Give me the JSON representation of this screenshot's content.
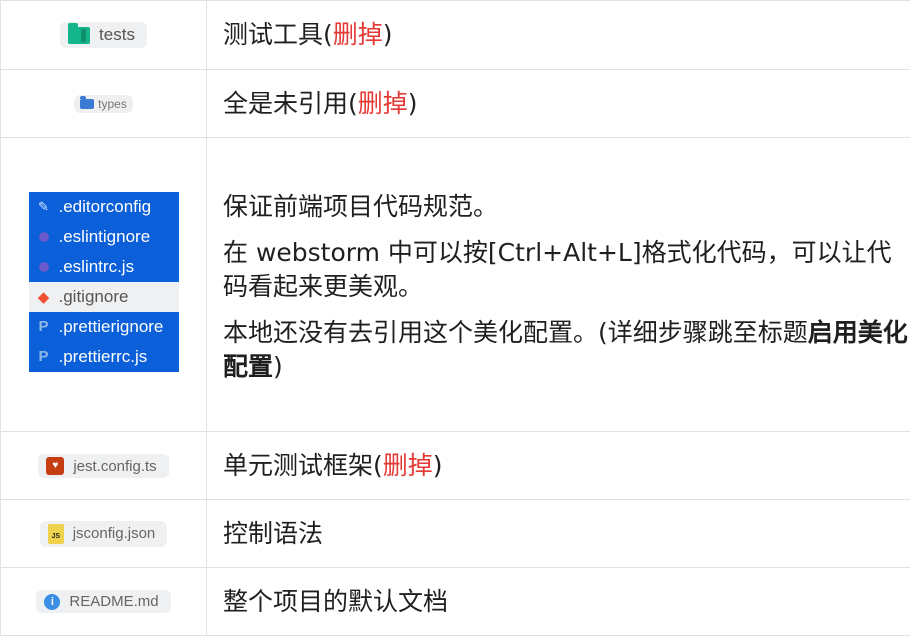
{
  "rows": [
    {
      "file": "tests",
      "desc": "测试工具(",
      "del": "删掉",
      "close": ")"
    },
    {
      "file": "types",
      "desc": "全是未引用(",
      "del": "删掉",
      "close": ")"
    },
    {
      "files": [
        ".editorconfig",
        ".eslintignore",
        ".eslintrc.js",
        ".gitignore",
        ".prettierignore",
        ".prettierrc.js"
      ],
      "para1": "保证前端项目代码规范。",
      "para2": "在 webstorm 中可以按[Ctrl+Alt+L]格式化代码，可以让代码看起来更美观。",
      "para3": "本地还没有去引用这个美化配置。(详细步骤跳至标题",
      "para3_bold": "启用美化配置",
      "para3_close": ")"
    },
    {
      "file": "jest.config.ts",
      "desc": "单元测试框架(",
      "del": "删掉",
      "close": ")"
    },
    {
      "file": "jsconfig.json",
      "desc": "控制语法"
    },
    {
      "file": "README.md",
      "desc": "整个项目的默认文档"
    }
  ],
  "icons": {
    "tests": "folder-icon",
    "types": "folder-icon",
    "jest": "jest-icon",
    "jsconfig": "js-file-icon",
    "readme": "info-icon"
  },
  "colors": {
    "delete_text": "#e53935",
    "selected_file_bg": "#0b5fd8"
  }
}
